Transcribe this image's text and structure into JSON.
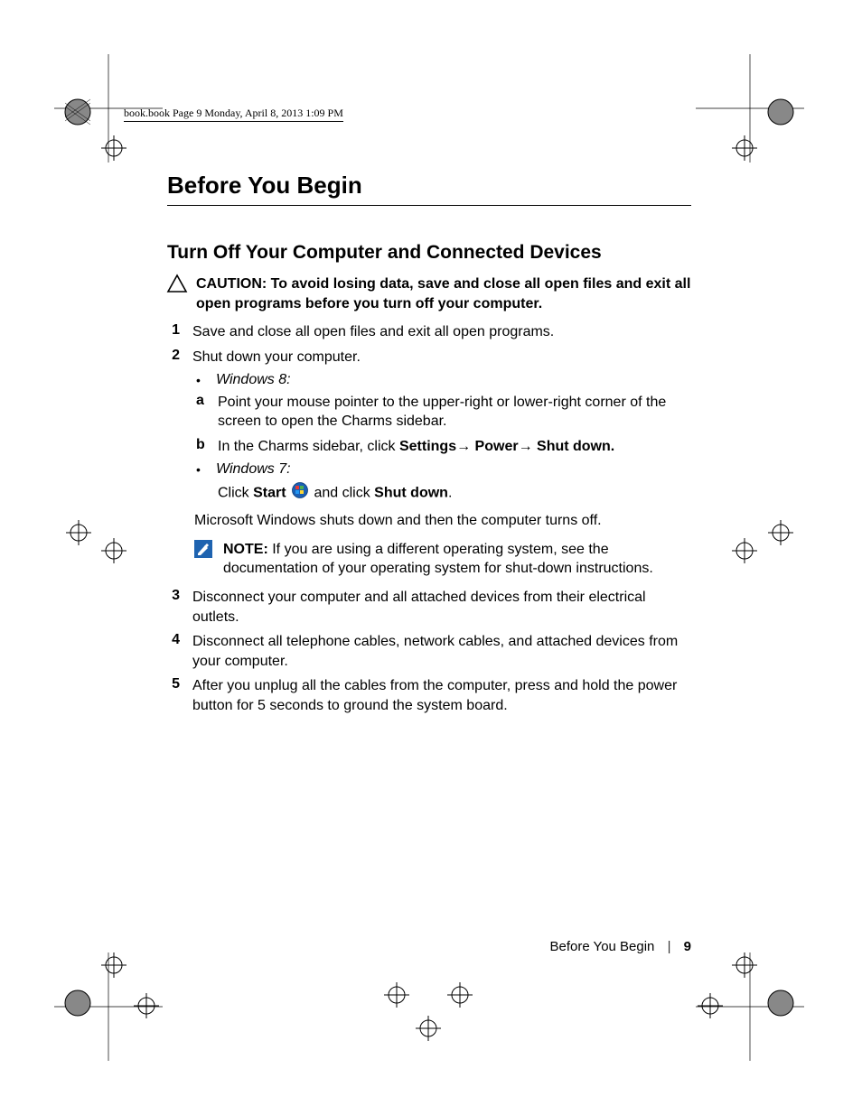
{
  "header": {
    "running": "book.book  Page 9  Monday, April 8, 2013  1:09 PM"
  },
  "title": "Before You Begin",
  "section": "Turn Off Your Computer and Connected Devices",
  "caution": "CAUTION: To avoid losing data, save and close all open files and exit all open programs before you turn off your computer.",
  "steps": {
    "s1": {
      "n": "1",
      "t": "Save and close all open files and exit all open programs."
    },
    "s2": {
      "n": "2",
      "t": "Shut down your computer."
    },
    "win8_label": "Windows 8:",
    "s2a": {
      "a": "a",
      "t": "Point your mouse pointer to the upper-right or lower-right corner of the screen to open the Charms sidebar."
    },
    "s2b_a": "b",
    "s2b_parts": {
      "p1": "In the Charms sidebar, click ",
      "settings": "Settings",
      "arrow1": "→ ",
      "power": "Power",
      "arrow2": "→ ",
      "shutdown": "Shut down."
    },
    "win7_label": "Windows 7:",
    "win7_parts": {
      "p1": "Click ",
      "start": "Start",
      "p2": " and click ",
      "shutdown": "Shut down",
      "p3": "."
    },
    "shut_text": "Microsoft Windows shuts down and then the computer turns off.",
    "note_lead": "NOTE:",
    "note_body": " If you are using a different operating system, see the documentation of your operating system for shut-down instructions.",
    "s3": {
      "n": "3",
      "t": "Disconnect your computer and all attached devices from their electrical outlets."
    },
    "s4": {
      "n": "4",
      "t": "Disconnect all telephone cables, network cables, and attached devices from your computer."
    },
    "s5": {
      "n": "5",
      "t": "After you unplug all the cables from the computer, press and hold the power button for 5 seconds to ground the system board."
    }
  },
  "footer": {
    "label": "Before You Begin",
    "sep": "|",
    "page": "9"
  }
}
